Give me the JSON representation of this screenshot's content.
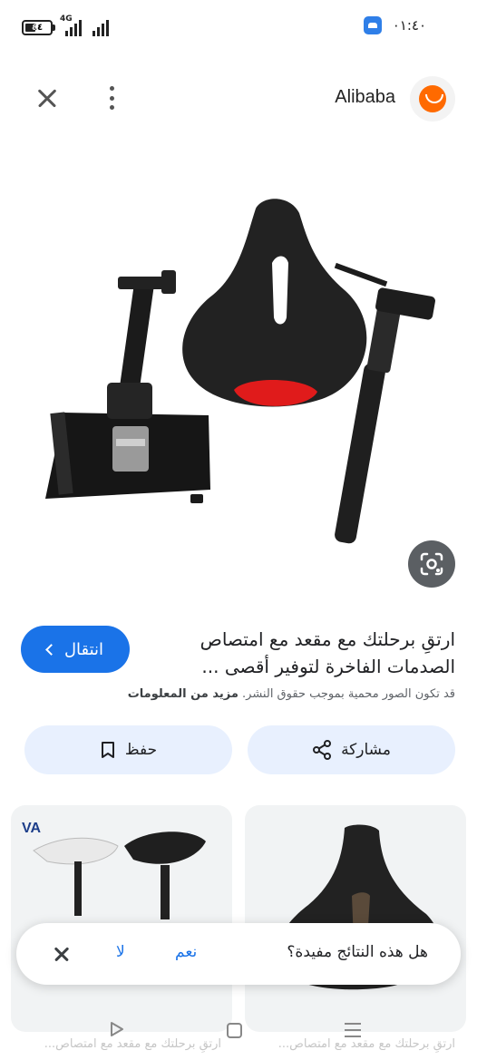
{
  "status_bar": {
    "battery_level": "٤٤",
    "network_type": "4G",
    "time": "٠١:٤٠"
  },
  "header": {
    "site_name": "Alibaba",
    "site_logo_icon": "alibaba-logo-icon",
    "close_icon": "close-icon",
    "more_icon": "more-vert-icon"
  },
  "product": {
    "title": "ارتقِ برحلتك مع مقعد مع امتصاص الصدمات الفاخرة لتوفير أقصى ...",
    "go_button_label": "انتقال",
    "copyright_notice": "قد تكون الصور محمية بموجب حقوق النشر.",
    "more_info_label": "مزيد من المعلومات",
    "lens_icon": "google-lens-icon"
  },
  "actions": {
    "share_label": "مشاركة",
    "save_label": "حفظ"
  },
  "related": {
    "captions": [
      "ارتقِ برحلتك مع مقعد مع امتصاص...",
      "ارتقِ برحلتك مع مقعد مع امتصاص..."
    ]
  },
  "feedback": {
    "question": "هل هذه النتائج مفيدة؟",
    "yes_label": "نعم",
    "no_label": "لا"
  },
  "colors": {
    "accent": "#1a73e8",
    "button_bg": "#e8f0fe",
    "brand_orange": "#ff6a00"
  }
}
